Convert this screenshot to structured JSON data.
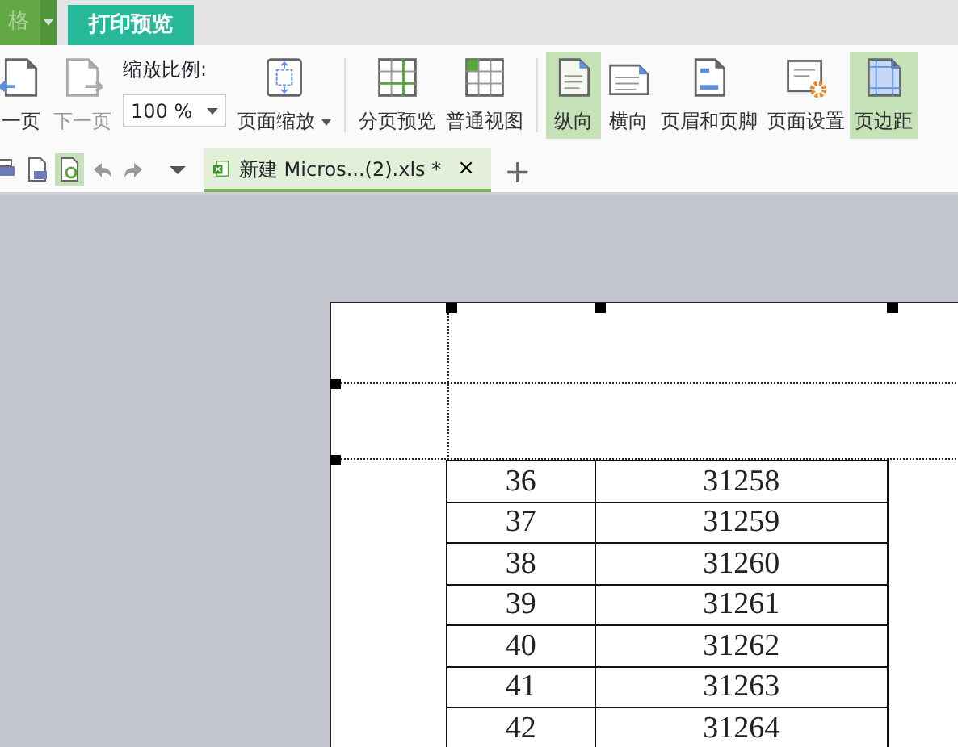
{
  "top_tabs": [
    {
      "label": "格",
      "selected": false
    },
    {
      "label": "打印预览",
      "selected": true
    }
  ],
  "ribbon": [
    {
      "kind": "page",
      "label": "一页",
      "disabled": false
    },
    {
      "kind": "page",
      "label": "下一页",
      "disabled": true
    },
    {
      "kind": "zoom",
      "caption": "缩放比例:",
      "value": "100 %"
    },
    {
      "kind": "menu",
      "label": "页面缩放"
    },
    {
      "kind": "divider"
    },
    {
      "kind": "page",
      "label": "分页预览",
      "disabled": false
    },
    {
      "kind": "page",
      "label": "普通视图",
      "disabled": false
    },
    {
      "kind": "divider"
    },
    {
      "kind": "toggle",
      "label": "纵向",
      "selected": true
    },
    {
      "kind": "toggle",
      "label": "横向",
      "selected": false
    },
    {
      "kind": "page",
      "label": "页眉和页脚",
      "disabled": false
    },
    {
      "kind": "page",
      "label": "页面设置",
      "disabled": false
    },
    {
      "kind": "toggle",
      "label": "页边距",
      "selected": true
    }
  ],
  "doc_tab": {
    "title": "新建 Micros...(2).xls *",
    "close": "×",
    "new": "+"
  },
  "table": {
    "rows": [
      [
        "36",
        "31258"
      ],
      [
        "37",
        "31259"
      ],
      [
        "38",
        "31260"
      ],
      [
        "39",
        "31261"
      ],
      [
        "40",
        "31262"
      ],
      [
        "41",
        "31263"
      ],
      [
        "42",
        "31264"
      ]
    ]
  }
}
